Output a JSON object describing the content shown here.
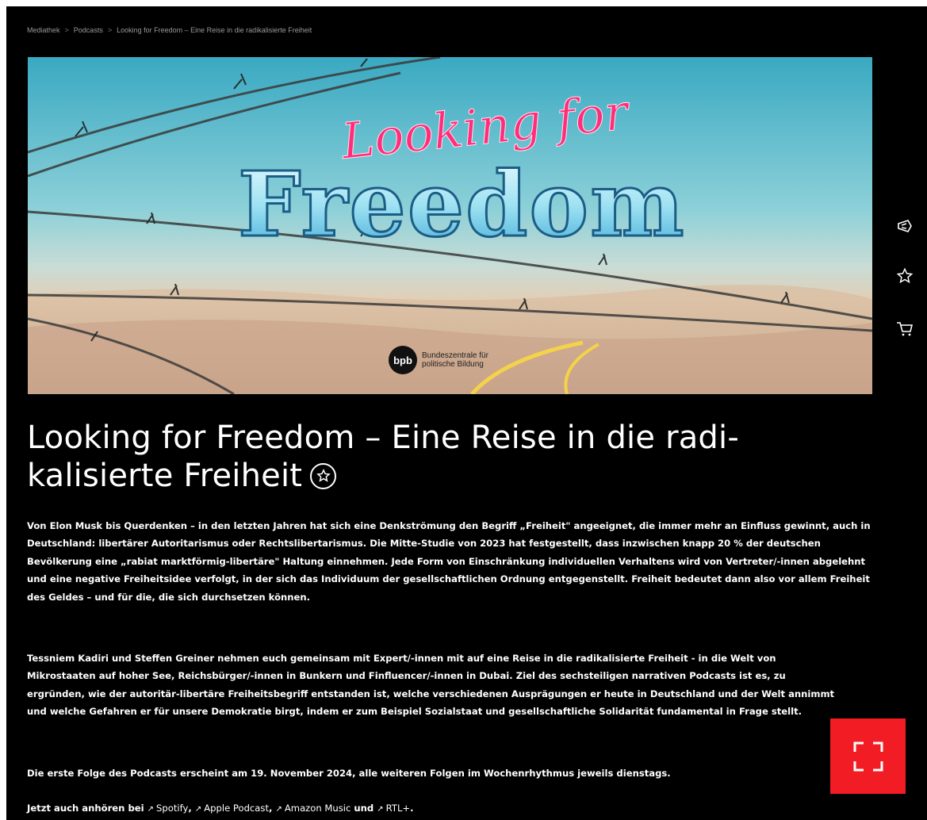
{
  "breadcrumb": {
    "items": [
      "Mediathek",
      "Podcasts",
      "Looking for Freedom – Eine Reise in die radikalisierte Freiheit"
    ],
    "separator": ">"
  },
  "hero": {
    "script_text": "Looking for",
    "main_text": "Freedom",
    "logo_text": "bpb",
    "logo_org_line1": "Bundeszentrale für",
    "logo_org_line2": "politische Bildung"
  },
  "side_actions": [
    {
      "name": "share-icon"
    },
    {
      "name": "favorite-star-icon"
    },
    {
      "name": "cart-icon"
    }
  ],
  "title": "Looking for Freedom – Eine Reise in die radi-kalisierte Freiheit",
  "title_line1": "Looking for Freedom – Eine Reise in die radi-",
  "title_line2": "kalisierte Freiheit",
  "paragraphs": {
    "p1": "Von Elon Musk bis Querdenken – in den letzten Jahren hat sich eine Denkströmung den Begriff „Freiheit\" angeeignet, die immer mehr an Einfluss gewinnt, auch in Deutschland: libertärer Autoritarismus oder Rechtslibertarismus. Die Mitte-Studie von 2023 hat festgestellt, dass inzwischen knapp 20 % der deutschen Bevölkerung eine „rabiat marktförmig-libertäre\" Haltung einnehmen. Jede Form von Einschränkung individuellen Verhaltens wird von Vertreter/-innen abgelehnt und eine negative Freiheitsidee verfolgt, in der sich das Individuum der gesellschaftlichen Ordnung entgegenstellt. Freiheit bedeutet dann also vor allem Freiheit des Geldes – und für die, die sich durchsetzen können.",
    "p2": "Tessniem Kadiri und Steffen Greiner nehmen euch gemeinsam mit Expert/-innen mit auf eine Reise in die radikalisierte Freiheit - in die Welt von Mikrostaaten auf hoher See, Reichsbürger/-innen in Bunkern und Finfluencer/-innen in Dubai. Ziel des sechsteiligen narrativen Podcasts ist es, zu ergründen, wie der autoritär-libertäre Freiheitsbegriff entstanden ist, welche verschiedenen Ausprägungen er heute in Deutschland und der Welt annimmt und welche Gefahren er für unsere Demokratie birgt, indem er zum Beispiel Sozialstaat und gesellschaftliche Solidarität fundamental in Frage stellt.",
    "p3": "Die erste Folge des Podcasts erscheint am 19. November 2024, alle weiteren Folgen im Wochenrhythmus jeweils dienstags.",
    "p4_prefix": "Jetzt auch anhören bei",
    "p4_links": [
      "Spotify",
      "Apple Podcast",
      "Amazon Music",
      "RTL+"
    ],
    "p4_sep1": ",",
    "p4_sep2": ",",
    "p4_and": "und",
    "p4_end": "."
  },
  "colors": {
    "background": "#000000",
    "accent": "#f21d24",
    "text": "#ffffff",
    "hero_pink": "#ff2d7a",
    "hero_blue": "#8fe3f2"
  }
}
